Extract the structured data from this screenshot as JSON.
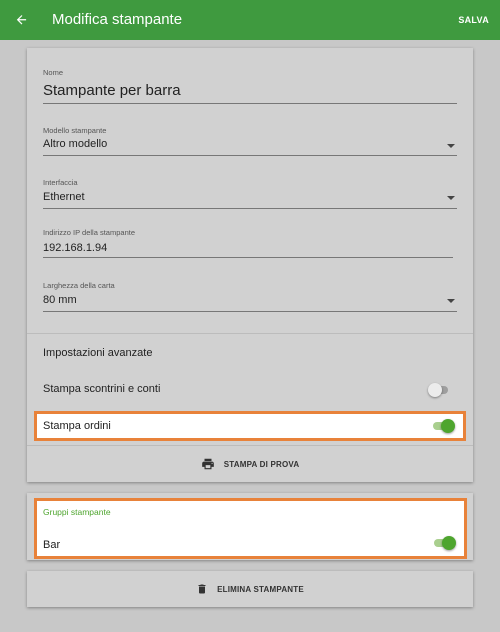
{
  "header": {
    "title": "Modifica stampante",
    "save_label": "SALVA",
    "back_icon": "arrow-left-icon"
  },
  "form": {
    "name": {
      "label": "Nome",
      "value": "Stampante per barra"
    },
    "model": {
      "label": "Modello stampante",
      "value": "Altro modello"
    },
    "interface": {
      "label": "Interfaccia",
      "value": "Ethernet"
    },
    "ip": {
      "label": "Indirizzo IP della stampante",
      "value": "192.168.1.94"
    },
    "paper_width": {
      "label": "Larghezza della carta",
      "value": "80 mm"
    }
  },
  "advanced": {
    "heading": "Impostazioni avanzate",
    "print_receipts": {
      "label": "Stampa scontrini e conti",
      "enabled": false
    },
    "print_orders": {
      "label": "Stampa ordini",
      "enabled": true
    }
  },
  "test_print": {
    "label": "STAMPA DI PROVA",
    "icon": "printer-icon"
  },
  "groups": {
    "title": "Gruppi stampante",
    "items": [
      {
        "label": "Bar",
        "enabled": true
      }
    ]
  },
  "delete_printer": {
    "label": "ELIMINA STAMPANTE",
    "icon": "trash-icon"
  },
  "colors": {
    "appbar": "#3f9a3f",
    "accent": "#4ea52e",
    "highlight_border": "#e8823a"
  }
}
